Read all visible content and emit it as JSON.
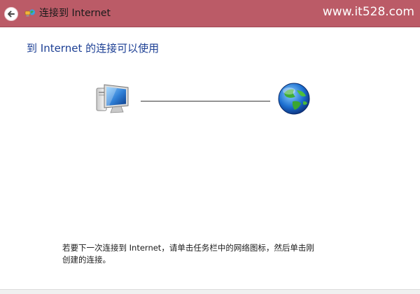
{
  "window": {
    "title": "连接到 Internet",
    "watermark": "www.it528.com"
  },
  "icons": {
    "back": "back-arrow-icon",
    "title": "network-connection-icon",
    "computer": "computer-icon",
    "internet": "globe-icon"
  },
  "main": {
    "heading": "到 Internet 的连接可以使用",
    "instruction": "若要下一次连接到 Internet，请单击任务栏中的网络图标，然后单击刚创建的连接。"
  },
  "colors": {
    "titlebar": "#bb5b67",
    "heading": "#1c3f94",
    "text": "#1a1a1a",
    "background": "#ffffff"
  }
}
